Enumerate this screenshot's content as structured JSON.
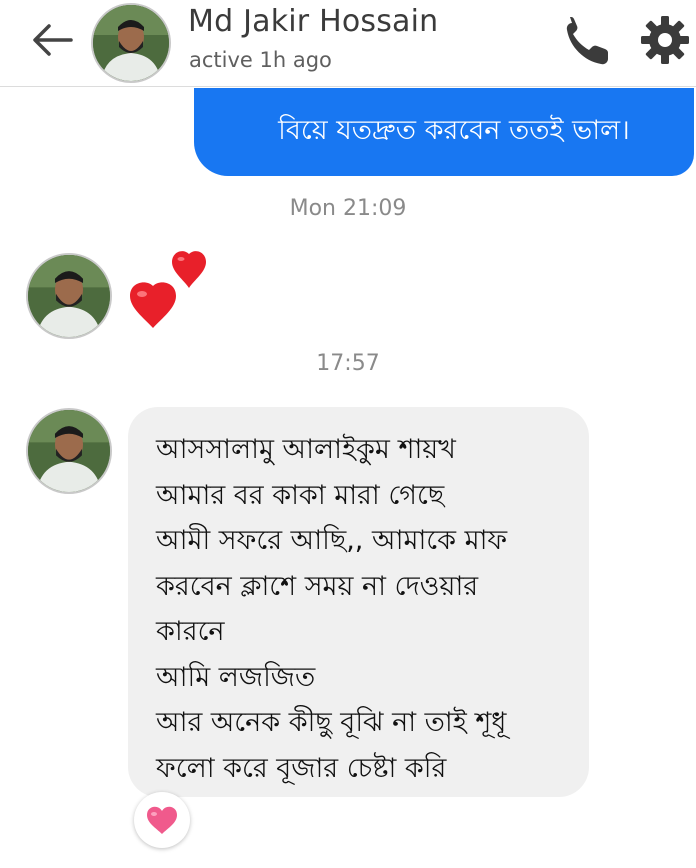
{
  "header": {
    "contact_name": "Md Jakir Hossain",
    "status": "active 1h ago",
    "back_icon": "arrow-left-icon",
    "call_icon": "phone-icon",
    "settings_icon": "gear-icon"
  },
  "messages": {
    "outgoing_1": "বিয়ে যতদ্রুত করবেন ততই ভাল।",
    "time_1": "Mon 21:09",
    "incoming_hearts_icon": "two-hearts-emoji",
    "time_2": "17:57",
    "incoming_2_lines": [
      "আসসালামু আলাইকুম শায়খ",
      "আমার বর কাকা মারা গেছে",
      "আমী সফরে আছি,, আমাকে মাফ",
      "করবেন ক্লাশে সময় না দেওয়ার",
      "কারনে",
      "আমি লজজিত",
      "আর অনেক কীছু বূঝি না তাই শূধূ",
      "ফলো করে বূজার চেষ্টা করি"
    ],
    "reaction_icon": "pink-heart-reaction"
  },
  "colors": {
    "outgoing_bubble": "#1877f2",
    "incoming_bubble": "#f0f0f0",
    "heart_red": "#e8202a",
    "reaction_pink": "#f05a8c"
  }
}
